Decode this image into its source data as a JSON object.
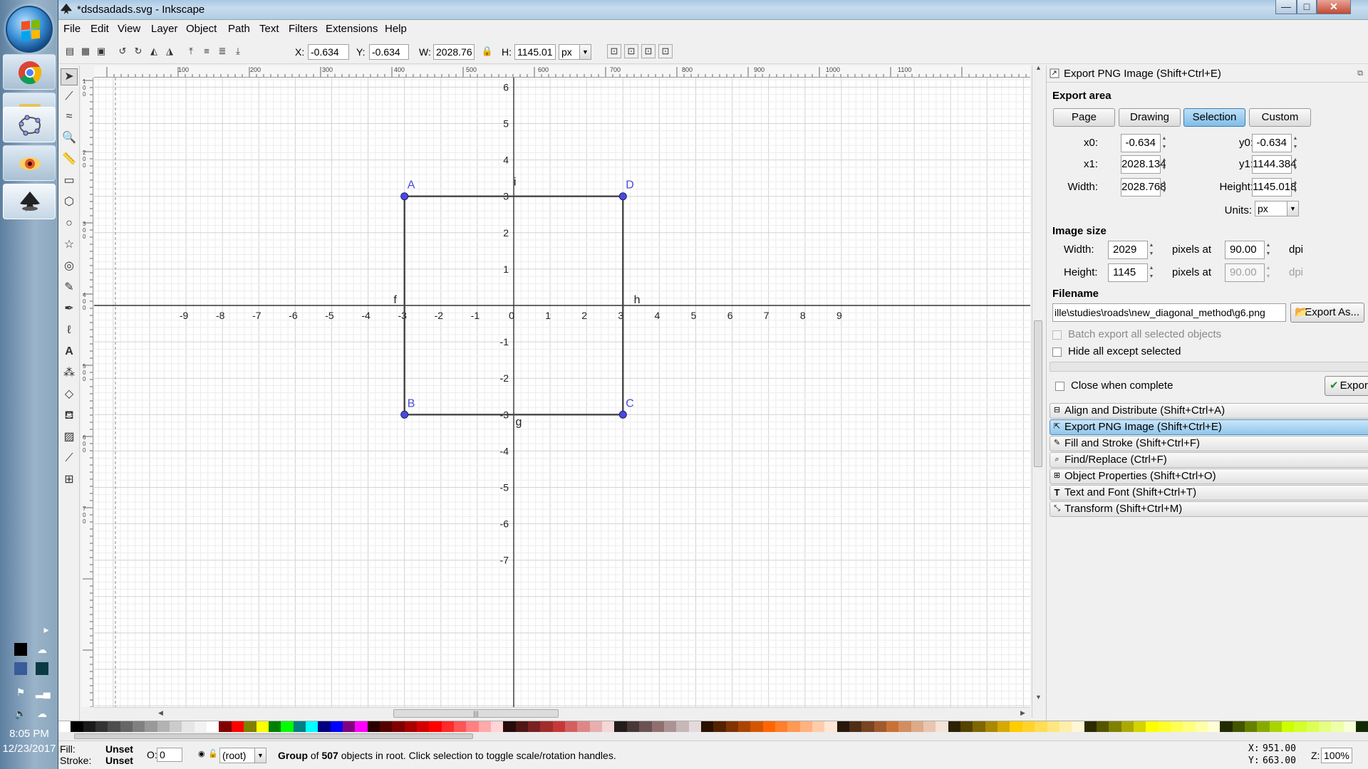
{
  "window": {
    "title": "*dsdsadads.svg - Inkscape",
    "minimize": "—",
    "maximize": "□",
    "close": "✕"
  },
  "menu": [
    "File",
    "Edit",
    "View",
    "Layer",
    "Object",
    "Path",
    "Text",
    "Filters",
    "Extensions",
    "Help"
  ],
  "toolbar": {
    "x_label": "X:",
    "x_value": "-0.634",
    "y_label": "Y:",
    "y_value": "-0.634",
    "w_label": "W:",
    "w_value": "2028.76",
    "h_label": "H:",
    "h_value": "1145.01",
    "unit": "px"
  },
  "canvas": {
    "x_ticks": [
      "-9",
      "-8",
      "-7",
      "-6",
      "-5",
      "-4",
      "-3",
      "-2",
      "-1",
      "0",
      "1",
      "2",
      "3",
      "4",
      "5",
      "6",
      "7",
      "8",
      "9"
    ],
    "y_ticks": [
      "6",
      "5",
      "4",
      "3",
      "2",
      "1",
      "-1",
      "-2",
      "-3",
      "-4",
      "-5",
      "-6",
      "-7"
    ],
    "hruler_labels": [
      "100",
      "200",
      "300",
      "400",
      "500",
      "600",
      "700",
      "800",
      "900",
      "1000",
      "1100"
    ],
    "vruler_labels": [
      "1",
      "0",
      "0",
      "2",
      "0",
      "0",
      "3",
      "0",
      "0",
      "4",
      "0",
      "0",
      "5",
      "0",
      "0",
      "6",
      "0",
      "0",
      "7",
      "0",
      "0"
    ],
    "points": [
      {
        "label": "A"
      },
      {
        "label": "B"
      },
      {
        "label": "C"
      },
      {
        "label": "D"
      }
    ],
    "edges": {
      "f": "f",
      "g": "g",
      "h": "h",
      "i": "i"
    }
  },
  "dock": {
    "title": "Export PNG Image (Shift+Ctrl+E)",
    "export_area_heading": "Export area",
    "area_buttons": [
      "Page",
      "Drawing",
      "Selection",
      "Custom"
    ],
    "selected_area": "Selection",
    "x0_label": "x0:",
    "x0": "-0.634",
    "y0_label": "y0:",
    "y0": "-0.634",
    "x1_label": "x1:",
    "x1": "2028.134",
    "y1_label": "y1:",
    "y1": "1144.384",
    "width_label": "Width:",
    "width": "2028.768",
    "height_label": "Height:",
    "height": "1145.018",
    "units_label": "Units:",
    "units": "px",
    "image_size_heading": "Image size",
    "img_width_label": "Width:",
    "img_width": "2029",
    "img_height_label": "Height:",
    "img_height": "1145",
    "pixels_at": "pixels at",
    "dpi_x": "90.00",
    "dpi_y": "90.00",
    "dpi": "dpi",
    "filename_heading": "Filename",
    "filename": "ille\\studies\\roads\\new_diagonal_method\\g6.png",
    "export_as": "Export As...",
    "batch_export": "Batch export all selected objects",
    "hide_all": "Hide all except selected",
    "close_when_complete": "Close when complete",
    "export_button": "Export",
    "panels": [
      {
        "label": "Align and Distribute (Shift+Ctrl+A)",
        "icon": "align-icon"
      },
      {
        "label": "Export PNG Image (Shift+Ctrl+E)",
        "icon": "export-icon"
      },
      {
        "label": "Fill and Stroke (Shift+Ctrl+F)",
        "icon": "fill-stroke-icon"
      },
      {
        "label": "Find/Replace (Ctrl+F)",
        "icon": "find-icon"
      },
      {
        "label": "Object Properties (Shift+Ctrl+O)",
        "icon": "object-properties-icon"
      },
      {
        "label": "Text and Font (Shift+Ctrl+T)",
        "icon": "text-font-icon"
      },
      {
        "label": "Transform (Shift+Ctrl+M)",
        "icon": "transform-icon"
      }
    ]
  },
  "status": {
    "fill_label": "Fill:",
    "fill_value": "Unset",
    "stroke_label": "Stroke:",
    "stroke_value": "Unset",
    "opacity_label": "O:",
    "opacity_value": "0",
    "layer": "(root)",
    "message_bold1": "Group",
    "message_mid": " of ",
    "message_bold2": "507",
    "message_rest": " objects in root. Click selection to toggle scale/rotation handles.",
    "cursor_x_label": "X:",
    "cursor_x": "951.00",
    "cursor_y_label": "Y:",
    "cursor_y": "663.00",
    "zoom_label": "Z:",
    "zoom": "100%"
  },
  "taskbar": {
    "time": "8:05 PM",
    "date": "12/23/2017"
  },
  "colors": {
    "accent": "#3c7fb1",
    "point": "#3a3ad9",
    "selected_button": "#7fbde9"
  }
}
